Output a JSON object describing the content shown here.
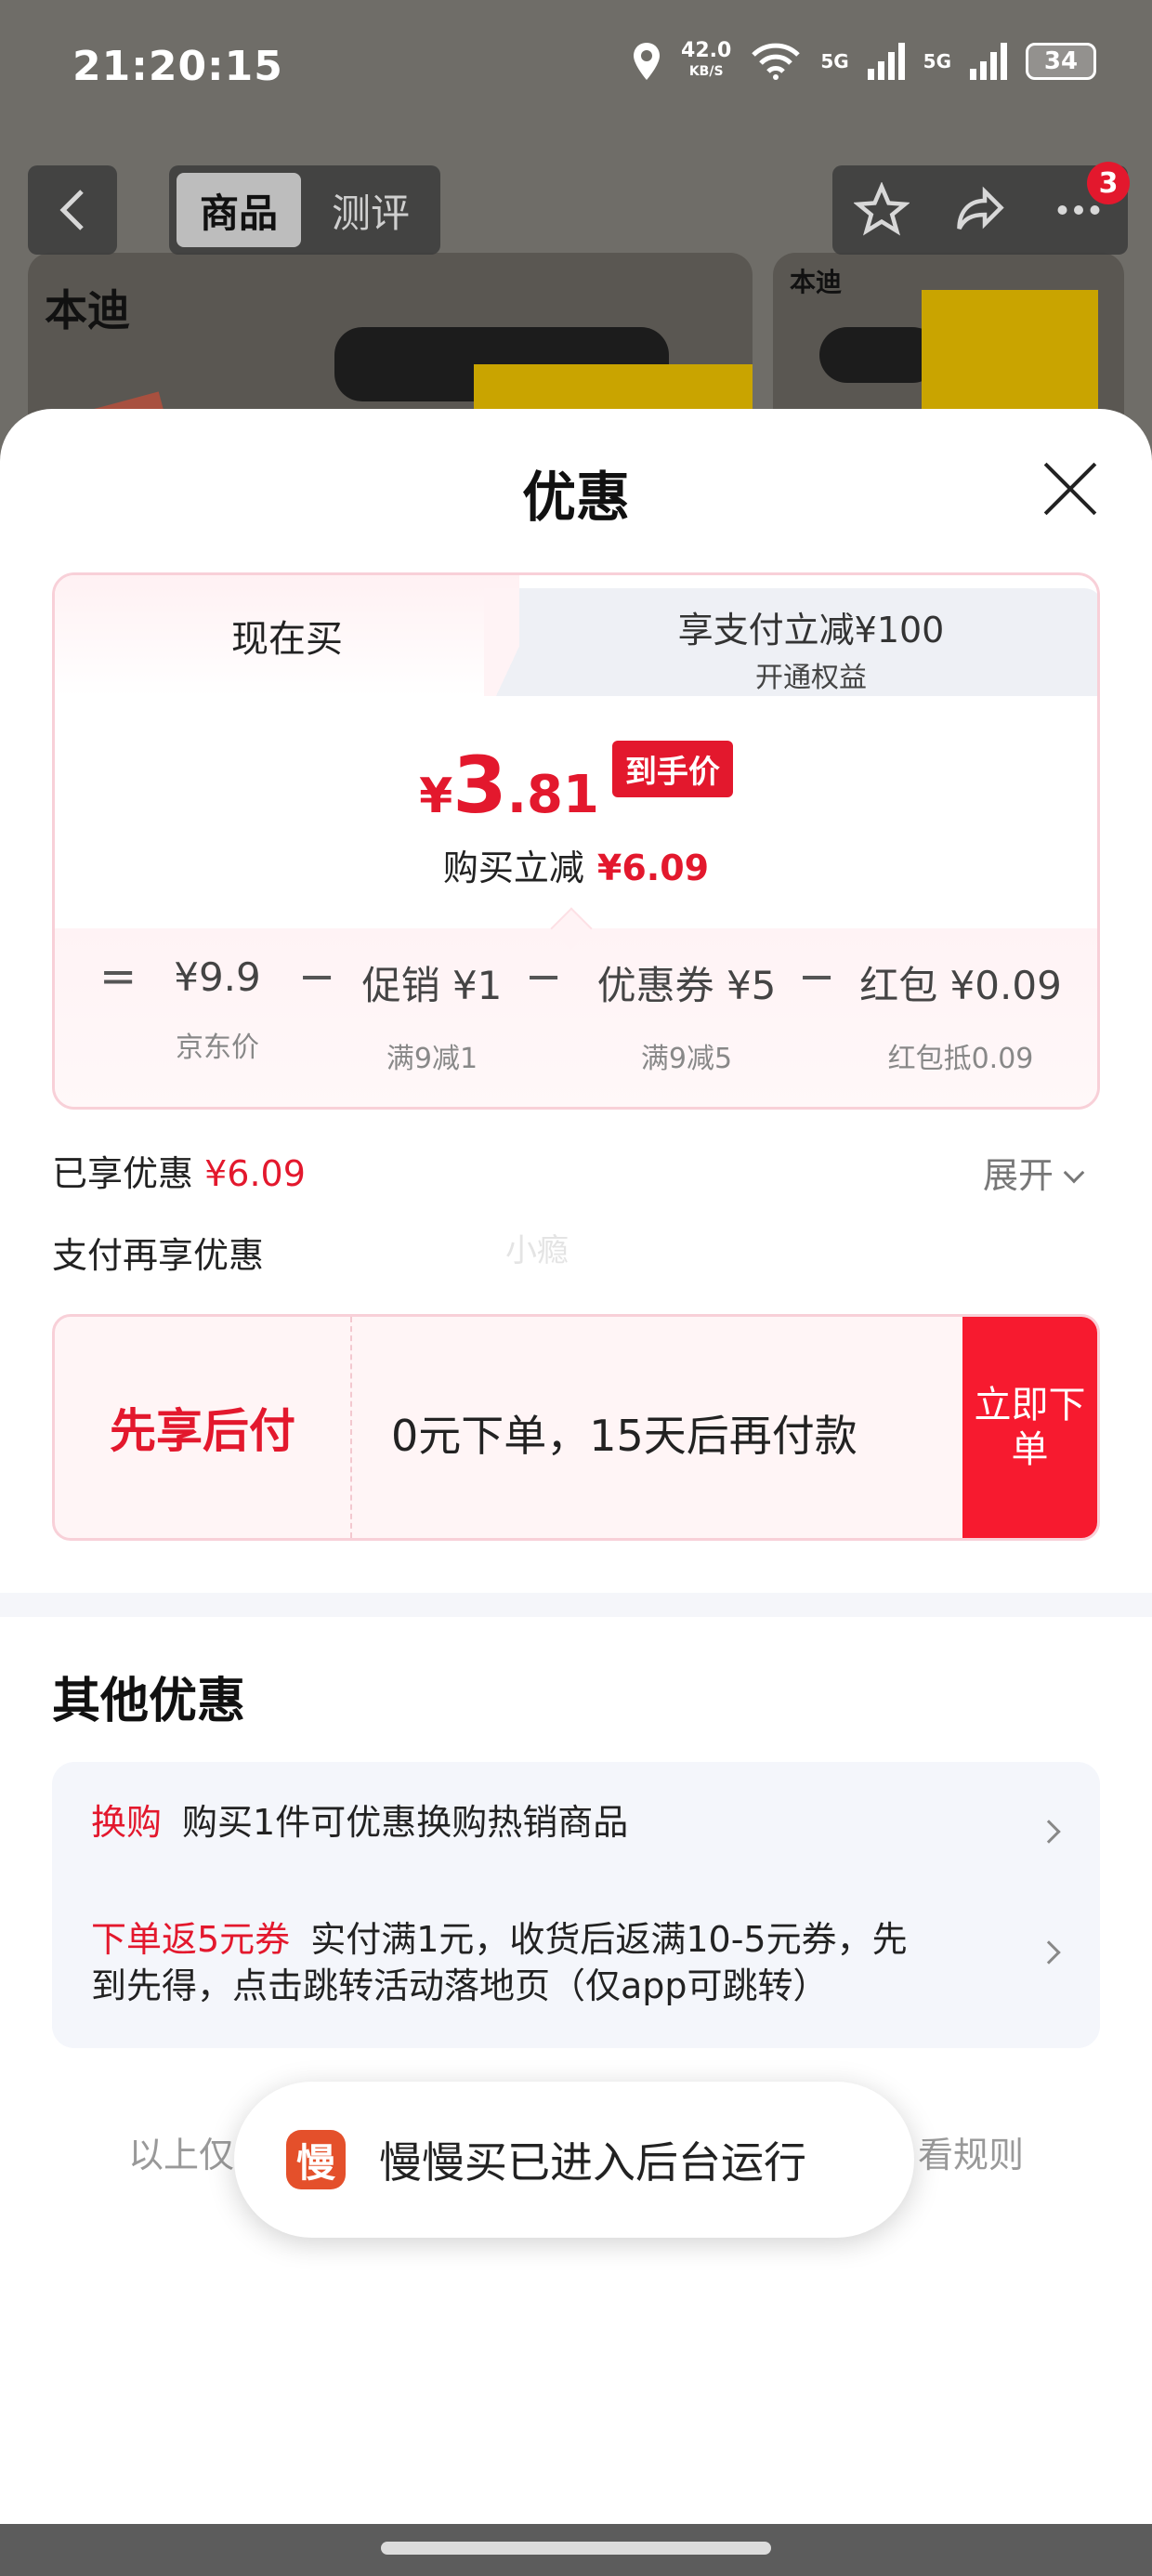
{
  "status_bar": {
    "time": "21:20:15",
    "net_speed": "42.0",
    "net_unit": "KB/S",
    "sig1": "5G",
    "sig2": "5G",
    "battery": "34"
  },
  "header": {
    "tabs": [
      {
        "label": "商品"
      },
      {
        "label": "测评"
      }
    ],
    "badge_count": "3",
    "brand": "本迪"
  },
  "sheet": {
    "title": "优惠"
  },
  "price_card": {
    "tab_now": "现在买",
    "tab_pay_line1": "享支付立减¥100",
    "tab_pay_line2": "开通权益",
    "final_yen": "¥",
    "final_int": "3",
    "final_dec": ".81",
    "final_tag": "到手价",
    "save_label": "购买立减",
    "save_amount": "¥6.09",
    "eq": "=",
    "minus": "−",
    "items": [
      {
        "top": "¥9.9",
        "bot": "京东价"
      },
      {
        "top": "促销 ¥1",
        "bot": "满9减1"
      },
      {
        "top": "优惠券 ¥5",
        "bot": "满9减5"
      },
      {
        "top": "红包 ¥0.09",
        "bot": "红包抵0.09"
      }
    ]
  },
  "enjoyed": {
    "label": "已享优惠",
    "amount": "¥6.09",
    "expand": "展开"
  },
  "pay_more": {
    "label": "支付再享优惠",
    "watermark": "小瘾"
  },
  "bnpl": {
    "label": "先享后付",
    "desc": "0元下单，15天后再付款",
    "cta": "立即下单"
  },
  "other": {
    "title": "其他优惠",
    "offers": [
      {
        "tag": "换购",
        "text": "购买1件可优惠换购热销商品"
      },
      {
        "tag": "下单返5元券",
        "text": "实付满1元，收货后返满10-5元券，先",
        "text2": "到先得，点击跳转活动落地页（仅app可跳转）"
      }
    ]
  },
  "rules": {
    "left": "以上仅",
    "right": "看规则"
  },
  "toast": {
    "logo": "慢",
    "message": "慢慢买已进入后台运行"
  },
  "colors": {
    "accent_red": "#e3182d",
    "cta_red": "#f71a2f"
  }
}
